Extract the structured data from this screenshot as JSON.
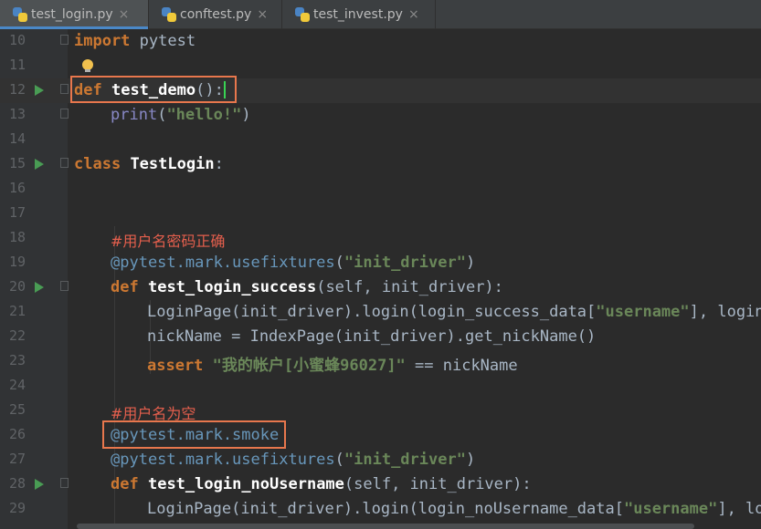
{
  "tabs": [
    {
      "label": "test_login.py",
      "active": true
    },
    {
      "label": "conftest.py",
      "active": false
    },
    {
      "label": "test_invest.py",
      "active": false
    }
  ],
  "tab_close_glyph": "×",
  "lines": {
    "l10": {
      "num": "10",
      "kw": "import",
      "mod": "pytest"
    },
    "l11": {
      "num": "11"
    },
    "l12": {
      "num": "12",
      "kw": "def",
      "name": "test_demo",
      "rest": "():"
    },
    "l13": {
      "num": "13",
      "bi": "print",
      "p1": "(",
      "s": "\"hello!\"",
      "p2": ")"
    },
    "l14": {
      "num": "14"
    },
    "l15": {
      "num": "15",
      "kw": "class",
      "name": "TestLogin",
      "rest": ":"
    },
    "l16": {
      "num": "16"
    },
    "l17": {
      "num": "17"
    },
    "l18": {
      "num": "18",
      "comment": "#用户名密码正确"
    },
    "l19": {
      "num": "19",
      "dec": "@pytest.mark.usefixtures",
      "p1": "(",
      "s": "\"init_driver\"",
      "p2": ")"
    },
    "l20": {
      "num": "20",
      "kw": "def",
      "name": "test_login_success",
      "rest": "(self, init_driver):"
    },
    "l21": {
      "num": "21",
      "a": "LoginPage(init_driver).login(login_success_data[",
      "s": "\"username\"",
      "b": "], login_"
    },
    "l22": {
      "num": "22",
      "text": "nickName = IndexPage(init_driver).get_nickName()"
    },
    "l23": {
      "num": "23",
      "kw": "assert",
      "s": "\"我的帐户[小蜜蜂96027]\"",
      "rest": " == nickName"
    },
    "l24": {
      "num": "24"
    },
    "l25": {
      "num": "25",
      "comment": "#用户名为空"
    },
    "l26": {
      "num": "26",
      "dec": "@pytest.mark.smoke"
    },
    "l27": {
      "num": "27",
      "dec": "@pytest.mark.usefixtures",
      "p1": "(",
      "s": "\"init_driver\"",
      "p2": ")"
    },
    "l28": {
      "num": "28",
      "kw": "def",
      "name": "test_login_noUsername",
      "rest": "(self, init_driver):"
    },
    "l29": {
      "num": "29",
      "a": "LoginPage(init_driver).login(login_noUsername_data[",
      "s": "\"username\"",
      "b": "], log"
    }
  },
  "colors": {
    "keyword": "#cc7832",
    "string": "#6a8759",
    "comment": "#e55f4d",
    "decorator": "#6897bb",
    "highlight_box": "#e8774d",
    "run_marker": "#499c54",
    "cursor": "#39d353"
  },
  "icons": [
    "python-file-icon",
    "close-icon",
    "run-gutter-icon",
    "fold-icon",
    "lightbulb-icon"
  ]
}
